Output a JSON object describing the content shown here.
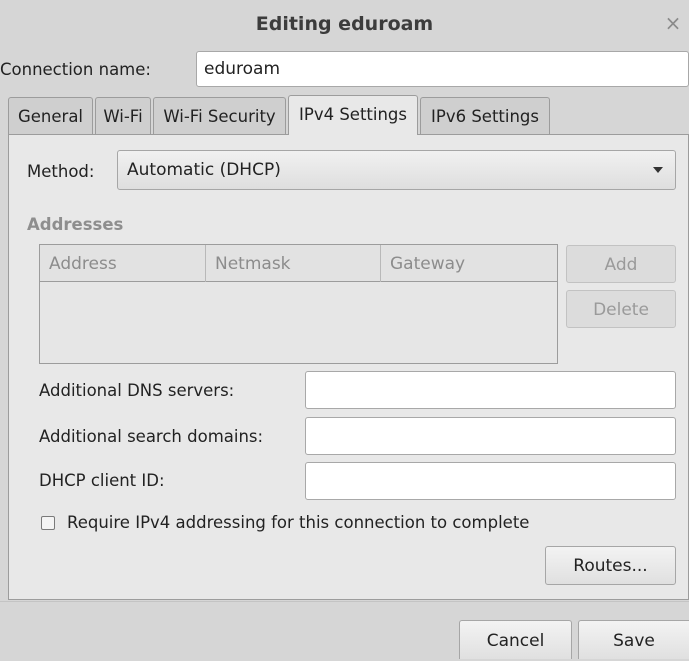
{
  "window": {
    "title": "Editing eduroam",
    "close_glyph": "×"
  },
  "connection": {
    "label": "Connection name:",
    "value": "eduroam"
  },
  "tabs": [
    {
      "label": "General"
    },
    {
      "label": "Wi-Fi"
    },
    {
      "label": "Wi-Fi Security"
    },
    {
      "label": "IPv4 Settings",
      "active": true
    },
    {
      "label": "IPv6 Settings"
    }
  ],
  "ipv4": {
    "method_label": "Method:",
    "method_value": "Automatic (DHCP)",
    "addresses_heading": "Addresses",
    "columns": [
      "Address",
      "Netmask",
      "Gateway"
    ],
    "add_label": "Add",
    "delete_label": "Delete",
    "dns_label": "Additional DNS servers:",
    "dns_value": "",
    "search_label": "Additional search domains:",
    "search_value": "",
    "dhcp_label": "DHCP client ID:",
    "dhcp_value": "",
    "require_label": "Require IPv4 addressing for this connection to complete",
    "require_checked": false,
    "routes_label": "Routes..."
  },
  "footer": {
    "cancel_label": "Cancel",
    "save_label": "Save"
  },
  "icons": {
    "dropdown": "chevron-down-icon",
    "close": "close-icon",
    "checkbox": "checkbox-icon"
  }
}
